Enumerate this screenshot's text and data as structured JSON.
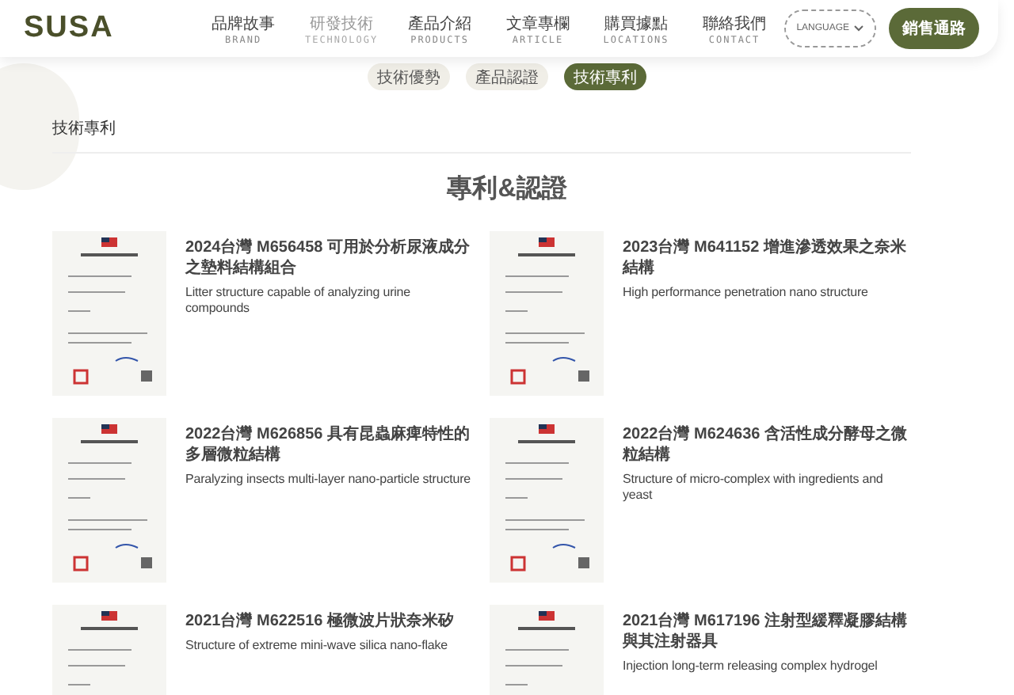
{
  "header": {
    "logo": "SUSA",
    "nav": [
      {
        "label": "品牌故事",
        "sub": "BRAND",
        "selected": false
      },
      {
        "label": "研發技術",
        "sub": "TECHNOLOGY",
        "selected": true
      },
      {
        "label": "產品介紹",
        "sub": "PRODUCTS",
        "selected": false
      },
      {
        "label": "文章專欄",
        "sub": "ARTICLE",
        "selected": false
      },
      {
        "label": "購買據點",
        "sub": "LOCATIONS",
        "selected": false
      },
      {
        "label": "聯絡我們",
        "sub": "CONTACT",
        "selected": false
      }
    ],
    "language": "LANGUAGE",
    "cta": "銷售通路"
  },
  "subtabs": [
    {
      "label": "技術優勢",
      "selected": false
    },
    {
      "label": "產品認證",
      "selected": false
    },
    {
      "label": "技術專利",
      "selected": true
    }
  ],
  "breadcrumb": "技術專利",
  "title": "專利&認證",
  "patents": [
    {
      "title": "2024台灣 M656458 可用於分析尿液成分之墊料結構組合",
      "subtitle": "Litter structure capable of analyzing urine compounds"
    },
    {
      "title": "2023台灣 M641152 增進滲透效果之奈米結構",
      "subtitle": "High performance penetration nano structure"
    },
    {
      "title": "2022台灣 M626856 具有昆蟲麻痺特性的多層微粒結構",
      "subtitle": "Paralyzing insects multi-layer nano-particle structure"
    },
    {
      "title": "2022台灣 M624636 含活性成分酵母之微粒結構",
      "subtitle": "Structure of micro-complex with ingredients and yeast"
    },
    {
      "title": "2021台灣 M622516 極微波片狀奈米矽",
      "subtitle": "Structure of extreme mini-wave silica nano-flake"
    },
    {
      "title": "2021台灣 M617196 注射型緩釋凝膠結構與其注射器具",
      "subtitle": "Injection long-term releasing complex hydrogel"
    }
  ]
}
